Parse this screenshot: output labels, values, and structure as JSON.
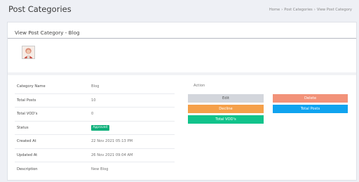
{
  "header": {
    "title": "Post Categories",
    "breadcrumb": [
      "Home",
      "Post Categories",
      "View Post Category"
    ],
    "separator": "›"
  },
  "card": {
    "title": "View Post Category - Blog",
    "avatar_alt": "category-image"
  },
  "details": [
    {
      "label": "Category Name",
      "value": "Blog"
    },
    {
      "label": "Total Posts",
      "value": "10"
    },
    {
      "label": "Total VOD's",
      "value": "0"
    },
    {
      "label": "Status",
      "value": "Approved"
    },
    {
      "label": "Created At",
      "value": "22 Nov 2021 05:13 PM"
    },
    {
      "label": "Updated At",
      "value": "26 Nov 2021 09:04 AM"
    },
    {
      "label": "Description",
      "value": "New Blog"
    }
  ],
  "actions": {
    "label": "Action",
    "edit": "Edit",
    "delete": "Delete",
    "decline": "Decline",
    "total_posts": "Total Posts",
    "total_vods": "Total VOD's"
  },
  "colors": {
    "status_badge": "#0fb07b",
    "delete": "#f29279",
    "decline": "#f5a04a",
    "total_posts": "#10a3ef",
    "total_vods": "#11c38b",
    "edit": "#d3d6dc"
  }
}
